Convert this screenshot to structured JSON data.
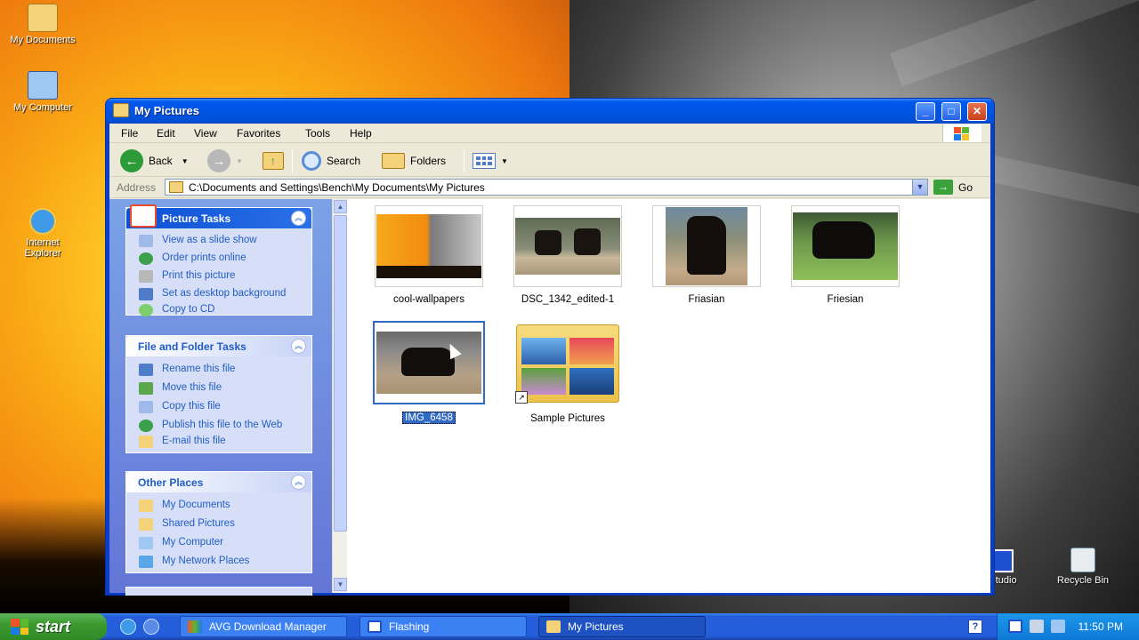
{
  "desktop": {
    "icons": [
      {
        "label": "My Documents",
        "icon": "my-documents-icon"
      },
      {
        "label": "My Computer",
        "icon": "my-computer-icon"
      },
      {
        "label": "Internet Explorer",
        "icon": "internet-explorer-icon"
      },
      {
        "label": "Studio",
        "icon": "studio-icon"
      },
      {
        "label": "Recycle Bin",
        "icon": "recycle-bin-icon"
      }
    ]
  },
  "window": {
    "title": "My Pictures",
    "menu": [
      "File",
      "Edit",
      "View",
      "Favorites",
      "Tools",
      "Help"
    ],
    "toolbar": {
      "back": "Back",
      "search": "Search",
      "folders": "Folders"
    },
    "address": {
      "label": "Address",
      "path": "C:\\Documents and Settings\\Bench\\My Documents\\My Pictures",
      "go": "Go"
    },
    "picture_tasks": {
      "title": "Picture Tasks",
      "items": [
        "View as a slide show",
        "Order prints online",
        "Print this picture",
        "Set as desktop background",
        "Copy to CD"
      ]
    },
    "file_tasks": {
      "title": "File and Folder Tasks",
      "items": [
        "Rename this file",
        "Move this file",
        "Copy this file",
        "Publish this file to the Web",
        "E-mail this file"
      ]
    },
    "other_places": {
      "title": "Other Places",
      "items": [
        "My Documents",
        "Shared Pictures",
        "My Computer",
        "My Network Places"
      ]
    },
    "files": [
      {
        "name": "cool-wallpapers",
        "kind": "image"
      },
      {
        "name": "DSC_1342_edited-1",
        "kind": "image"
      },
      {
        "name": "Friasian",
        "kind": "image"
      },
      {
        "name": "Friesian",
        "kind": "image"
      },
      {
        "name": "IMG_6458",
        "kind": "image",
        "selected": true
      },
      {
        "name": "Sample Pictures",
        "kind": "folder"
      }
    ]
  },
  "taskbar": {
    "start": "start",
    "tasks": [
      {
        "label": "AVG Download Manager",
        "active": false
      },
      {
        "label": "Flashing",
        "active": false
      },
      {
        "label": "My Pictures",
        "active": true
      }
    ],
    "clock": "11:50 PM"
  },
  "colors": {
    "accent": "#0054e3",
    "link": "#215dc6",
    "selection": "#316ac5",
    "start_green": "#3c9a2f"
  }
}
